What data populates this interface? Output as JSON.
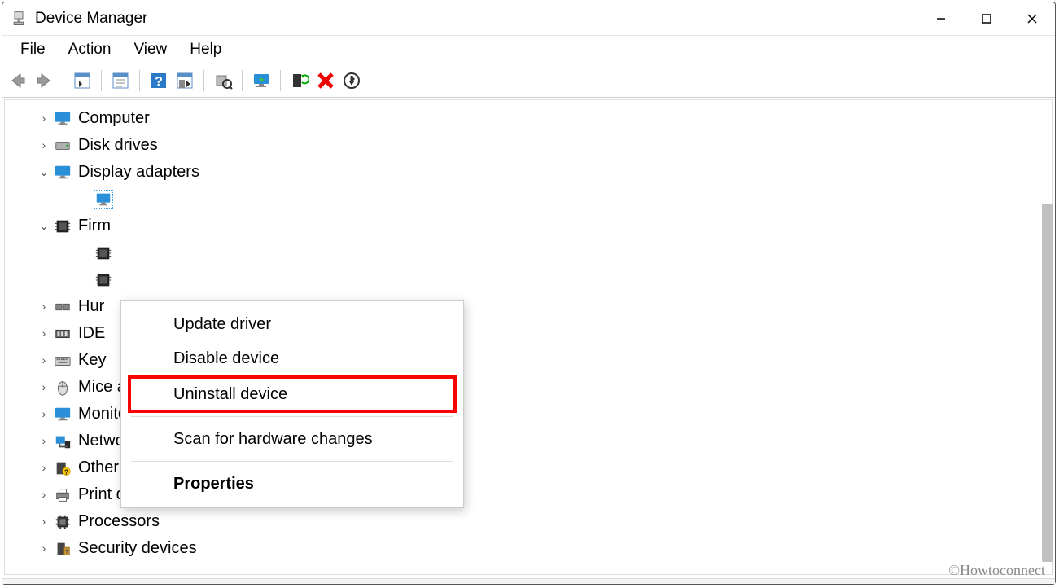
{
  "window": {
    "title": "Device Manager"
  },
  "menubar": [
    "File",
    "Action",
    "View",
    "Help"
  ],
  "context_menu": {
    "items": [
      {
        "label": "Update driver",
        "highlight": false
      },
      {
        "label": "Disable device",
        "highlight": false
      },
      {
        "label": "Uninstall device",
        "highlight": true
      },
      "---",
      {
        "label": "Scan for hardware changes",
        "highlight": false
      },
      "---",
      {
        "label": "Properties",
        "highlight": false,
        "bold": true
      }
    ]
  },
  "tree": [
    {
      "level": 1,
      "label": "Computer",
      "expander": "›",
      "icon": "monitor"
    },
    {
      "level": 1,
      "label": "Disk drives",
      "expander": "›",
      "icon": "disk"
    },
    {
      "level": 1,
      "label": "Display adapters",
      "expander": "⌄",
      "icon": "monitor"
    },
    {
      "level": 2,
      "label": "",
      "expander": "",
      "icon": "monitor-small",
      "selected": true
    },
    {
      "level": 1,
      "label": "Firm",
      "expander": "⌄",
      "icon": "chip",
      "truncated": true
    },
    {
      "level": 2,
      "label": "",
      "expander": "",
      "icon": "chip"
    },
    {
      "level": 2,
      "label": "",
      "expander": "",
      "icon": "chip"
    },
    {
      "level": 1,
      "label": "Hur",
      "expander": "›",
      "icon": "hid",
      "truncated": true
    },
    {
      "level": 1,
      "label": "IDE",
      "expander": "›",
      "icon": "ide",
      "truncated": true
    },
    {
      "level": 1,
      "label": "Key",
      "expander": "›",
      "icon": "keyboard",
      "truncated": true
    },
    {
      "level": 1,
      "label": "Mice and other pointing devices",
      "expander": "›",
      "icon": "mouse"
    },
    {
      "level": 1,
      "label": "Monitors",
      "expander": "›",
      "icon": "monitor"
    },
    {
      "level": 1,
      "label": "Network adapters",
      "expander": "›",
      "icon": "network"
    },
    {
      "level": 1,
      "label": "Other devices",
      "expander": "›",
      "icon": "other"
    },
    {
      "level": 1,
      "label": "Print queues",
      "expander": "›",
      "icon": "printer"
    },
    {
      "level": 1,
      "label": "Processors",
      "expander": "›",
      "icon": "cpu"
    },
    {
      "level": 1,
      "label": "Security devices",
      "expander": "›",
      "icon": "security"
    }
  ],
  "toolbar_icons": [
    "back",
    "forward",
    "|",
    "up-list",
    "|",
    "tree-view",
    "|",
    "help",
    "detail-view",
    "|",
    "settings",
    "|",
    "monitor",
    "|",
    "update-driver",
    "remove",
    "scan"
  ],
  "watermark": "©Howtoconnect"
}
